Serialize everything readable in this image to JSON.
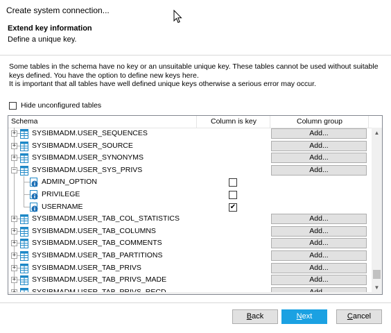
{
  "window": {
    "title": "Create system connection..."
  },
  "header": {
    "title": "Extend key information",
    "subtitle": "Define a unique key."
  },
  "description": [
    "Some tables in the schema have no key or an unsuitable unique key.  These tables cannot be used without suitable",
    "keys defined.  You have the option to define new keys here.",
    "It is important that all tables have well defined unique keys otherwise a serious error may occur."
  ],
  "hide_unconfigured": {
    "label": "Hide unconfigured tables",
    "checked": false
  },
  "grid": {
    "columns": {
      "schema": "Schema",
      "key": "Column is key",
      "group": "Column group"
    },
    "add_label": "Add...",
    "rows": [
      {
        "type": "table",
        "label": "SYSIBMADM.USER_SEQUENCES",
        "expanded": false
      },
      {
        "type": "table",
        "label": "SYSIBMADM.USER_SOURCE",
        "expanded": false
      },
      {
        "type": "table",
        "label": "SYSIBMADM.USER_SYNONYMS",
        "expanded": false
      },
      {
        "type": "table",
        "label": "SYSIBMADM.USER_SYS_PRIVS",
        "expanded": true
      },
      {
        "type": "column",
        "label": "ADMIN_OPTION",
        "is_key": false
      },
      {
        "type": "column",
        "label": "PRIVILEGE",
        "is_key": false
      },
      {
        "type": "column",
        "label": "USERNAME",
        "is_key": true
      },
      {
        "type": "table",
        "label": "SYSIBMADM.USER_TAB_COL_STATISTICS",
        "expanded": false
      },
      {
        "type": "table",
        "label": "SYSIBMADM.USER_TAB_COLUMNS",
        "expanded": false
      },
      {
        "type": "table",
        "label": "SYSIBMADM.USER_TAB_COMMENTS",
        "expanded": false
      },
      {
        "type": "table",
        "label": "SYSIBMADM.USER_TAB_PARTITIONS",
        "expanded": false
      },
      {
        "type": "table",
        "label": "SYSIBMADM.USER_TAB_PRIVS",
        "expanded": false
      },
      {
        "type": "table",
        "label": "SYSIBMADM.USER_TAB_PRIVS_MADE",
        "expanded": false
      },
      {
        "type": "table",
        "label": "SYSIBMADM.USER_TAB_PRIVS_RECD",
        "expanded": false
      }
    ]
  },
  "buttons": {
    "back": {
      "accel": "B",
      "rest": "ack"
    },
    "next": {
      "accel": "N",
      "rest": "ext"
    },
    "cancel": {
      "accel": "C",
      "rest": "ancel"
    }
  },
  "colors": {
    "accent": "#1ba1e2",
    "table_icon": "#1e88c7",
    "info_icon": "#1c6fb5"
  }
}
